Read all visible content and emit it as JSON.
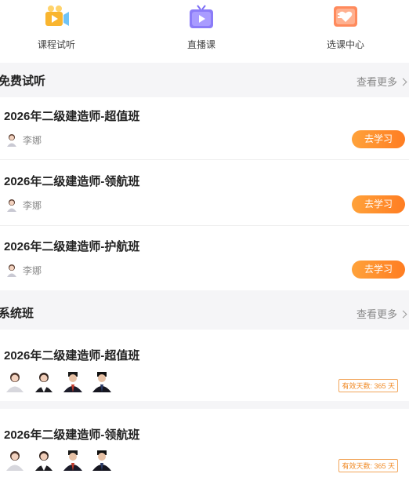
{
  "nav": {
    "items": [
      {
        "label": "课程试听",
        "icon": "video-camera-icon"
      },
      {
        "label": "直播课",
        "icon": "tv-icon"
      },
      {
        "label": "选课中心",
        "icon": "heart-box-icon"
      }
    ]
  },
  "free_trial": {
    "title": "免费试听",
    "more": "查看更多",
    "courses": [
      {
        "title": "2026年二级建造师-超值班",
        "teacher": "李娜",
        "button": "去学习"
      },
      {
        "title": "2026年二级建造师-领航班",
        "teacher": "李娜",
        "button": "去学习"
      },
      {
        "title": "2026年二级建造师-护航班",
        "teacher": "李娜",
        "button": "去学习"
      }
    ]
  },
  "system_class": {
    "title": "系统班",
    "more": "查看更多",
    "courses": [
      {
        "title": "2026年二级建造师-超值班",
        "badge": "有效天数: 365 天"
      },
      {
        "title": "2026年二级建造师-领航班",
        "badge": "有效天数: 365 天"
      }
    ]
  },
  "colors": {
    "accent": "#ff8a2a",
    "nav_icon_1": "#f9b52f",
    "nav_icon_2": "#7a6cf6",
    "nav_icon_3": "#ff7a50"
  }
}
